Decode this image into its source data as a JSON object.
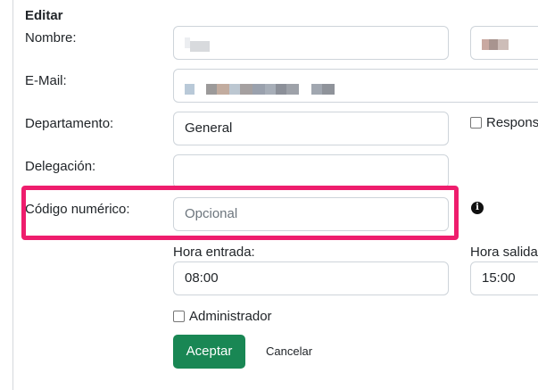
{
  "form": {
    "title": "Editar",
    "nombre_label": "Nombre:",
    "email_label": "E-Mail:",
    "departamento_label": "Departamento:",
    "departamento_value": "General",
    "responsable_label": "Respons",
    "delegacion_label": "Delegación:",
    "delegacion_value": "",
    "codigo_label": "Código numérico:",
    "codigo_placeholder": "Opcional",
    "hora_entrada_label": "Hora entrada:",
    "hora_entrada_value": "08:00",
    "hora_salida_label": "Hora salida",
    "hora_salida_value": "15:00",
    "administrador_label": "Administrador",
    "accept_label": "Aceptar",
    "cancel_label": "Cancelar"
  },
  "colors": {
    "highlight": "#ee1d6d",
    "primary_button": "#198754"
  },
  "icons": {
    "info": "info-circle-icon"
  }
}
